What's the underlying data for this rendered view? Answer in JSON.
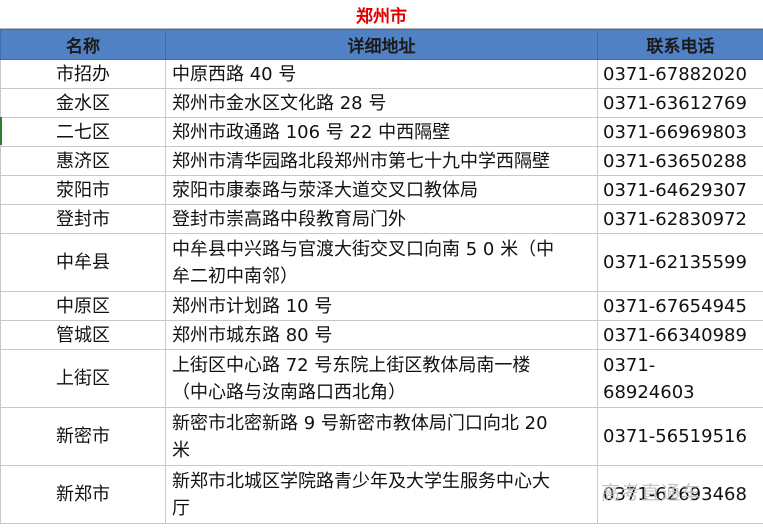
{
  "title": "郑州市",
  "headers": {
    "district": "名称",
    "address": "详细地址",
    "phone": "联系电话"
  },
  "rows": [
    {
      "district": "市招办",
      "address": "中原西路 40 号",
      "phone": "0371-67882020"
    },
    {
      "district": "金水区",
      "address": "郑州市金水区文化路 28 号",
      "phone": "0371-63612769"
    },
    {
      "district": "二七区",
      "address": "郑州市政通路 106 号 22 中西隔壁",
      "phone": "0371-66969803"
    },
    {
      "district": "惠济区",
      "address": "郑州市清华园路北段郑州市第七十九中学西隔壁",
      "phone": "0371-63650288"
    },
    {
      "district": "荥阳市",
      "address": "荥阳市康泰路与荥泽大道交叉口教体局",
      "phone": "0371-64629307"
    },
    {
      "district": "登封市",
      "address": "登封市崇高路中段教育局门外",
      "phone": "0371-62830972"
    },
    {
      "district": "中牟县",
      "address": "中牟县中兴路与官渡大街交叉口向南 5 0 米（中\n牟二初中南邻）",
      "phone": "0371-62135599"
    },
    {
      "district": "中原区",
      "address": "郑州市计划路 10 号",
      "phone": "0371-67654945"
    },
    {
      "district": "管城区",
      "address": "郑州市城东路 80 号",
      "phone": "0371-66340989"
    },
    {
      "district": "上街区",
      "address": "上街区中心路 72 号东院上街区教体局南一楼\n（中心路与汝南路口西北角）",
      "phone": "0371-\n68924603"
    },
    {
      "district": "新密市",
      "address": "新密市北密新路 9 号新密市教体局门口向北 20\n米",
      "phone": "0371-56519516"
    },
    {
      "district": "新郑市",
      "address": "新郑市北城区学院路青少年及大学生服务中心大\n厅",
      "phone": "0371-62693468"
    }
  ],
  "watermark": "高考直通车",
  "colors": {
    "title": "#e00000",
    "header_bg": "#4f81c4",
    "grid": "#c8c8c8"
  }
}
